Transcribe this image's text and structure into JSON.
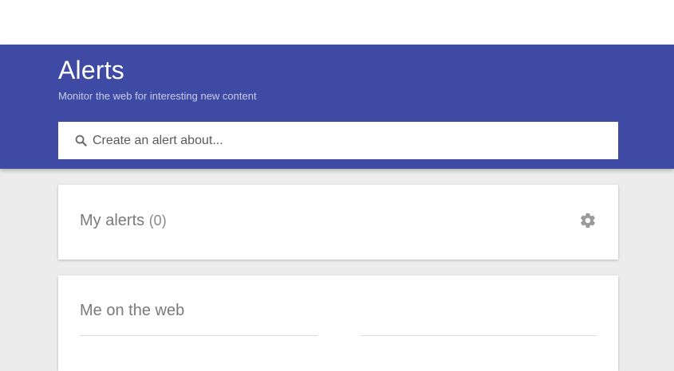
{
  "header": {
    "title": "Alerts",
    "subtitle": "Monitor the web for interesting new content",
    "color": "#3f4aa5"
  },
  "search": {
    "placeholder": "Create an alert about...",
    "icon": "search-icon"
  },
  "my_alerts": {
    "title": "My alerts",
    "count": "(0)",
    "settings_icon": "gear-icon"
  },
  "me_on_web": {
    "title": "Me on the web"
  }
}
